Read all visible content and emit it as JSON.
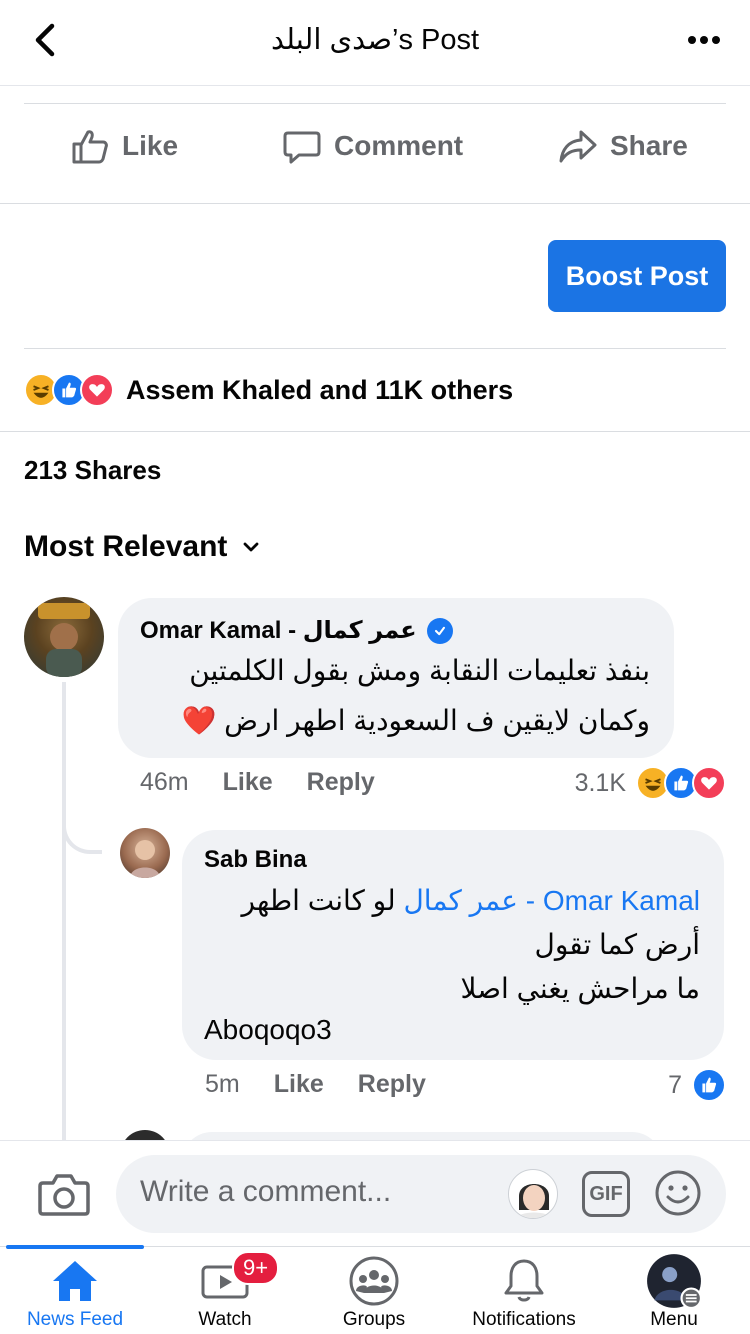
{
  "header": {
    "title": "صدى البلد’s Post"
  },
  "actions": {
    "like": "Like",
    "comment": "Comment",
    "share": "Share"
  },
  "boost": {
    "label": "Boost Post"
  },
  "reactions": {
    "summary": "Assem Khaled and 11K others"
  },
  "shares": {
    "label": "213 Shares"
  },
  "sort": {
    "label": "Most Relevant"
  },
  "comments": [
    {
      "author": "Omar Kamal - عمر كمال",
      "verified": true,
      "lines": [
        "بنفذ تعليمات النقابة ومش بقول الكلمتين",
        "وكمان لايقين ف السعودية اطهر ارض ❤️"
      ],
      "time": "46m",
      "like": "Like",
      "reply": "Reply",
      "reaction_count": "3.1K"
    },
    {
      "author": "Sab Bina",
      "mention": "Omar Kamal - عمر كمال",
      "line1_rest": "لو كانت اطهر",
      "lines": [
        "أرض كما تقول",
        "ما مراحش يغني اصلا"
      ],
      "signature": "Aboqoqo3",
      "time": "5m",
      "like": "Like",
      "reply": "Reply",
      "reaction_count": "7"
    }
  ],
  "composer": {
    "placeholder": "Write a comment...",
    "gif": "GIF"
  },
  "tabs": [
    {
      "label": "News Feed",
      "icon": "home-icon",
      "active": true
    },
    {
      "label": "Watch",
      "icon": "watch-icon",
      "badge": "9+"
    },
    {
      "label": "Groups",
      "icon": "groups-icon"
    },
    {
      "label": "Notifications",
      "icon": "bell-icon"
    },
    {
      "label": "Menu",
      "icon": "menu-avatar-icon"
    }
  ],
  "colors": {
    "accent": "#1877f2",
    "boost": "#1b74e4",
    "badge": "#e41e3f",
    "bubble": "#f0f2f5",
    "meta": "#65676b"
  }
}
